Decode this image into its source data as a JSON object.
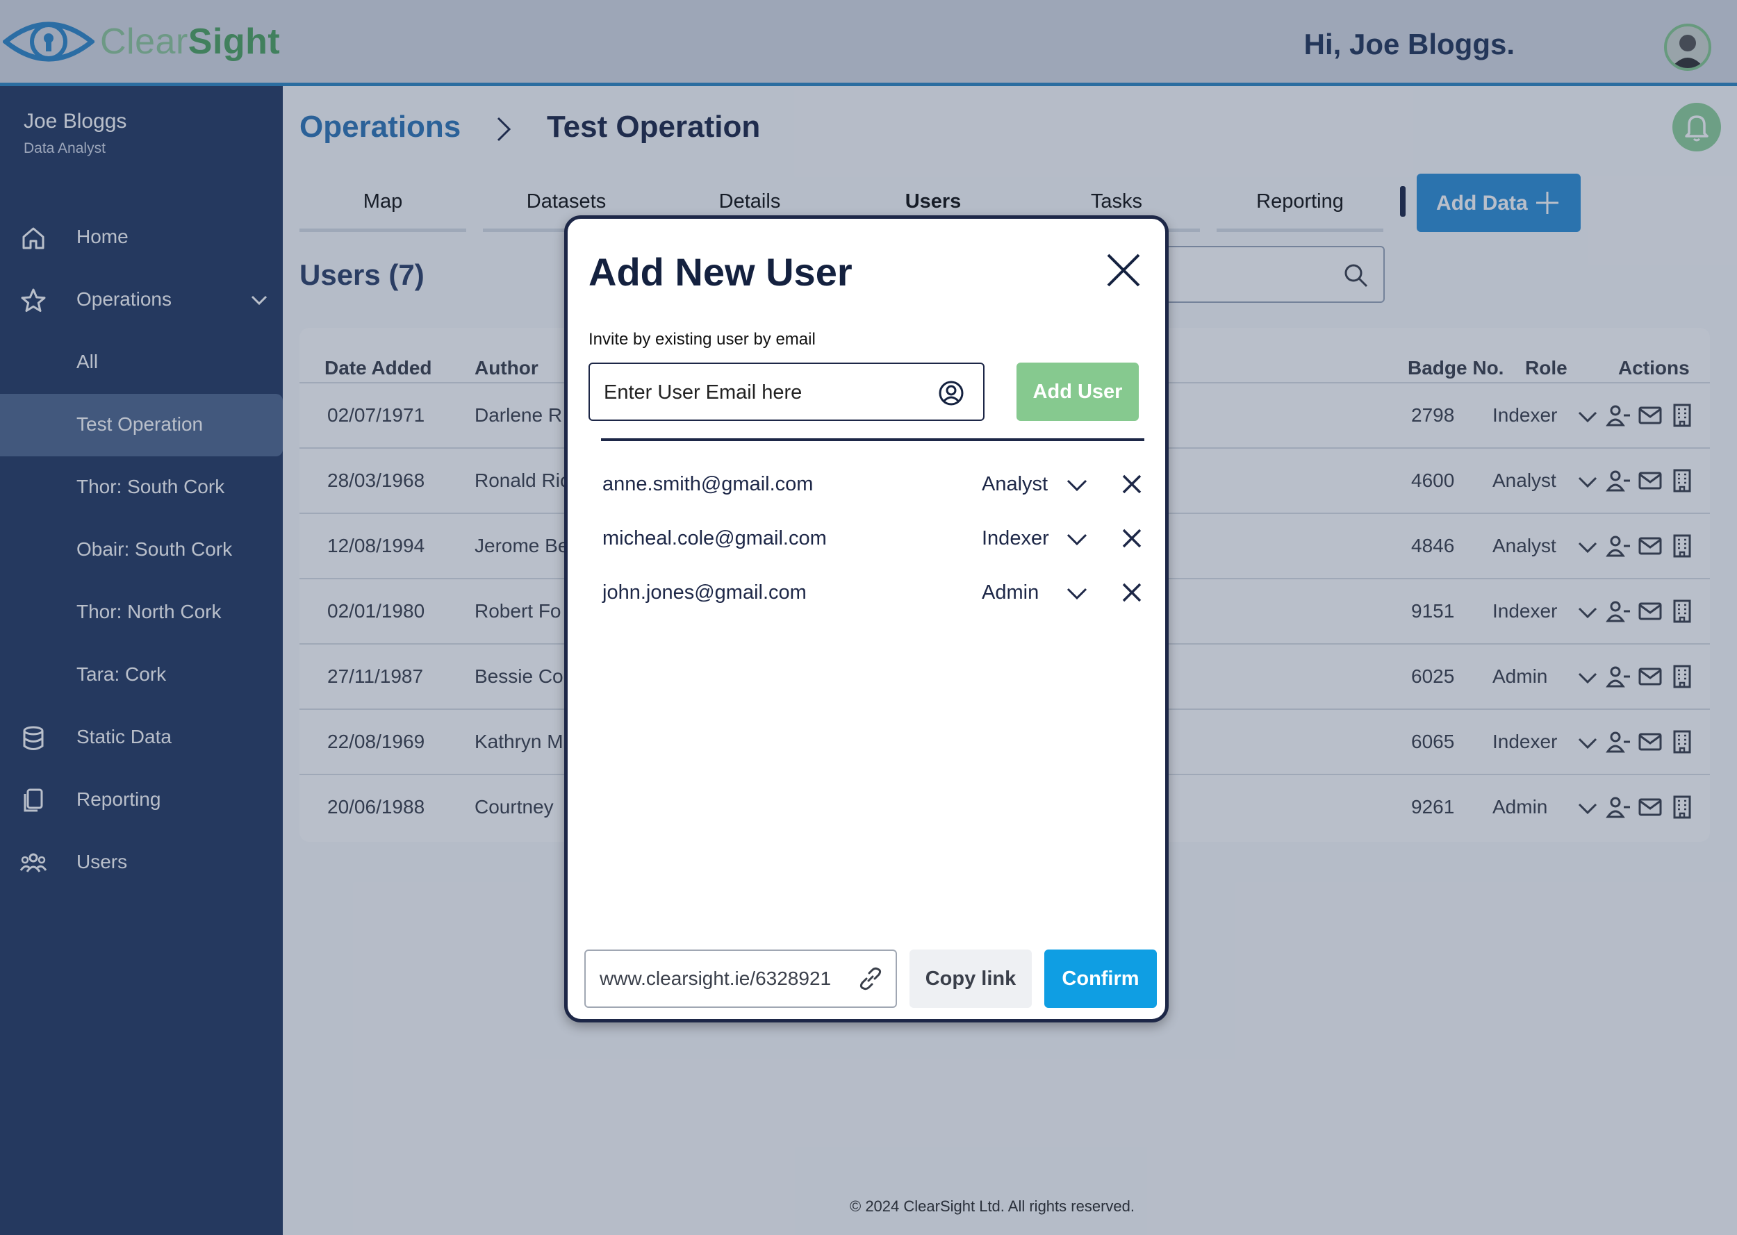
{
  "header": {
    "brand_light": "Clear",
    "brand_bold": "Sight",
    "greeting": "Hi, Joe Bloggs.",
    "avatar_icon": "user-avatar",
    "logo_icon": "eye-keyhole-logo"
  },
  "sidebar": {
    "user_name": "Joe Bloggs",
    "user_role": "Data Analyst",
    "items": [
      {
        "label": "Home",
        "icon": "home-icon"
      },
      {
        "label": "Operations",
        "icon": "star-icon"
      },
      {
        "label": "All"
      },
      {
        "label": "Test Operation"
      },
      {
        "label": "Thor: South Cork"
      },
      {
        "label": "Obair: South Cork"
      },
      {
        "label": "Thor: North Cork"
      },
      {
        "label": "Tara: Cork"
      },
      {
        "label": "Static Data",
        "icon": "database-icon"
      },
      {
        "label": "Reporting",
        "icon": "documents-icon"
      },
      {
        "label": "Users",
        "icon": "users-icon"
      }
    ]
  },
  "breadcrumb": {
    "parent": "Operations",
    "current": "Test Operation"
  },
  "tabs": [
    "Map",
    "Datasets",
    "Details",
    "Users",
    "Tasks",
    "Reporting"
  ],
  "add_data_label": "Add Data",
  "users_title": "Users (7)",
  "table": {
    "headers": [
      "Date Added",
      "Author",
      "Badge No.",
      "Role",
      "Actions"
    ],
    "rows": [
      {
        "date": "02/07/1971",
        "author": "Darlene R",
        "badge": "2798",
        "role": "Indexer"
      },
      {
        "date": "28/03/1968",
        "author": "Ronald Ric",
        "badge": "4600",
        "role": "Analyst"
      },
      {
        "date": "12/08/1994",
        "author": "Jerome Be",
        "badge": "4846",
        "role": "Analyst"
      },
      {
        "date": "02/01/1980",
        "author": "Robert Fo",
        "badge": "9151",
        "role": "Indexer"
      },
      {
        "date": "27/11/1987",
        "author": "Bessie Co",
        "badge": "6025",
        "role": "Admin"
      },
      {
        "date": "22/08/1969",
        "author": "Kathryn M",
        "badge": "6065",
        "role": "Indexer"
      },
      {
        "date": "20/06/1988",
        "author": "Courtney",
        "badge": "9261",
        "role": "Admin"
      }
    ]
  },
  "footer": "© 2024 ClearSight Ltd. All rights reserved.",
  "modal": {
    "title": "Add New User",
    "invite_label": "Invite by existing user by email",
    "email_placeholder": "Enter User Email here",
    "add_user_label": "Add User",
    "users": [
      {
        "email": "anne.smith@gmail.com",
        "role": "Analyst"
      },
      {
        "email": "micheal.cole@gmail.com",
        "role": "Indexer"
      },
      {
        "email": "john.jones@gmail.com",
        "role": "Admin"
      }
    ],
    "link": "www.clearsight.ie/6328921",
    "copy_label": "Copy link",
    "confirm_label": "Confirm"
  },
  "colors": {
    "brand_blue": "#2f8fd6",
    "sidebar_bg": "#253a62",
    "confirm": "#0f9ee3",
    "add_user": "#86c98f"
  }
}
